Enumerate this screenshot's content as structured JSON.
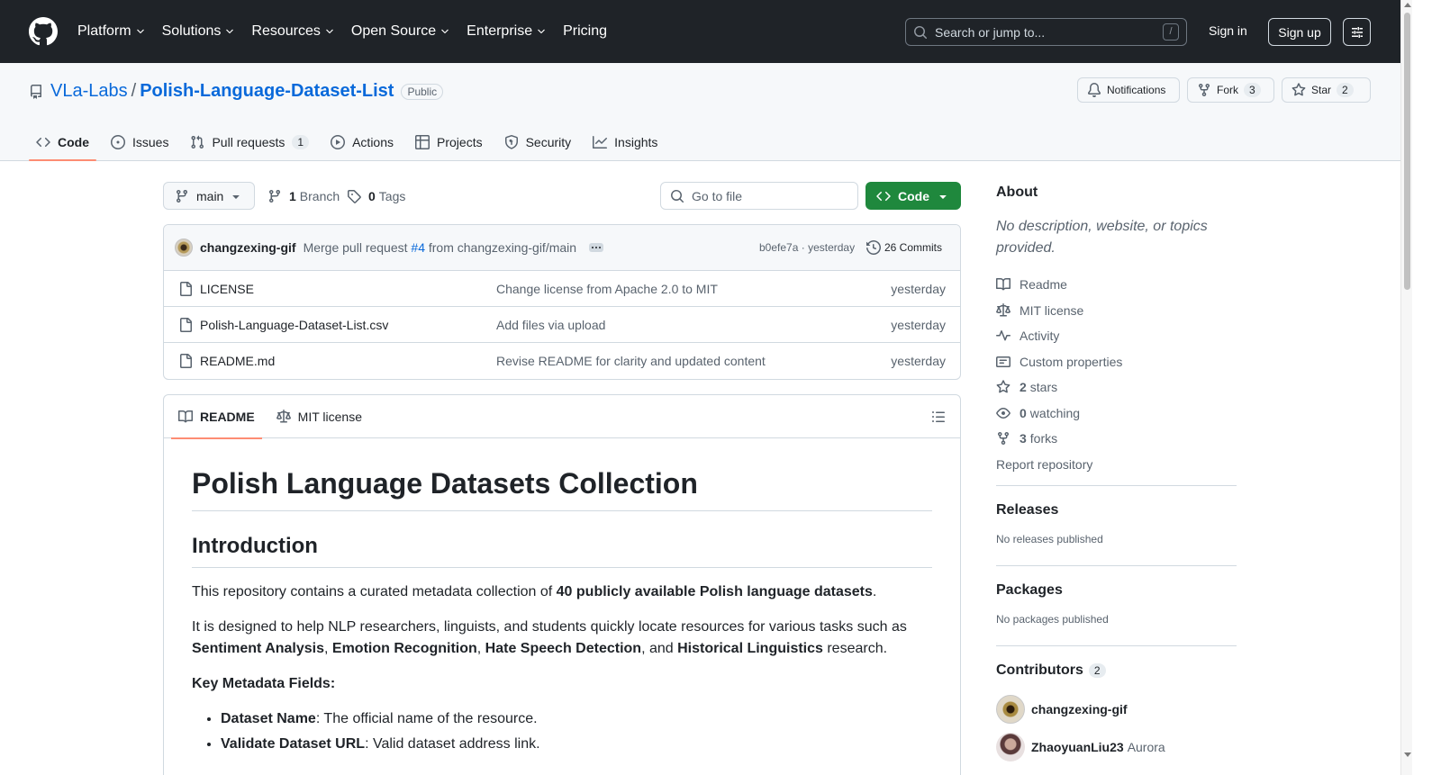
{
  "header": {
    "nav": [
      "Platform",
      "Solutions",
      "Resources",
      "Open Source",
      "Enterprise",
      "Pricing"
    ],
    "search_placeholder": "Search or jump to...",
    "search_shortcut": "/",
    "signin": "Sign in",
    "signup": "Sign up"
  },
  "repo": {
    "owner": "VLa-Labs",
    "separator": "/",
    "name": "Polish-Language-Dataset-List",
    "visibility": "Public",
    "notifications": "Notifications",
    "fork_label": "Fork",
    "fork_count": "3",
    "star_label": "Star",
    "star_count": "2"
  },
  "tabs": [
    {
      "label": "Code"
    },
    {
      "label": "Issues"
    },
    {
      "label": "Pull requests",
      "count": "1"
    },
    {
      "label": "Actions"
    },
    {
      "label": "Projects"
    },
    {
      "label": "Security"
    },
    {
      "label": "Insights"
    }
  ],
  "toolbar": {
    "branch": "main",
    "branch_count": "1",
    "branch_label": "Branch",
    "tag_count": "0",
    "tag_label": "Tags",
    "goto_placeholder": "Go to file",
    "code_label": "Code"
  },
  "commit": {
    "author": "changzexing-gif",
    "msg_prefix": "Merge pull request",
    "pr": "#4",
    "msg_suffix": "from changzexing-gif/main",
    "sha": "b0efe7a",
    "sep": "·",
    "time": "yesterday",
    "commits": "26 Commits"
  },
  "files": [
    {
      "name": "LICENSE",
      "message": "Change license from Apache 2.0 to MIT",
      "date": "yesterday"
    },
    {
      "name": "Polish-Language-Dataset-List.csv",
      "message": "Add files via upload",
      "date": "yesterday"
    },
    {
      "name": "README.md",
      "message": "Revise README for clarity and updated content",
      "date": "yesterday"
    }
  ],
  "readme": {
    "tab_readme": "README",
    "tab_license": "MIT license",
    "h1": "Polish Language Datasets Collection",
    "h2": "Introduction",
    "p1_pre": "This repository contains a curated metadata collection of ",
    "p1_bold": "40 publicly available Polish language datasets",
    "p1_post": ".",
    "p2_pre": "It is designed to help NLP researchers, linguists, and students quickly locate resources for various tasks such as ",
    "p2_b1": "Sentiment Analysis",
    "p2_c1": ", ",
    "p2_b2": "Emotion Recognition",
    "p2_c2": ", ",
    "p2_b3": "Hate Speech Detection",
    "p2_c3": ", and ",
    "p2_b4": "Historical Linguistics",
    "p2_post": " research.",
    "p3": "Key Metadata Fields:",
    "li1_b": "Dataset Name",
    "li1_t": ": The official name of the resource.",
    "li2_b": "Validate Dataset URL",
    "li2_t": ": Valid dataset address link."
  },
  "about": {
    "title": "About",
    "description": "No description, website, or topics provided.",
    "readme": "Readme",
    "license": "MIT license",
    "activity": "Activity",
    "custom": "Custom properties",
    "stars_n": "2",
    "stars": "stars",
    "watching_n": "0",
    "watching": "watching",
    "forks_n": "3",
    "forks": "forks",
    "report": "Report repository"
  },
  "releases": {
    "title": "Releases",
    "note": "No releases published"
  },
  "packages": {
    "title": "Packages",
    "note": "No packages published"
  },
  "contributors": {
    "title": "Contributors",
    "count": "2",
    "list": [
      {
        "login": "changzexing-gif",
        "name": ""
      },
      {
        "login": "ZhaoyuanLiu23",
        "name": "Aurora"
      }
    ]
  }
}
